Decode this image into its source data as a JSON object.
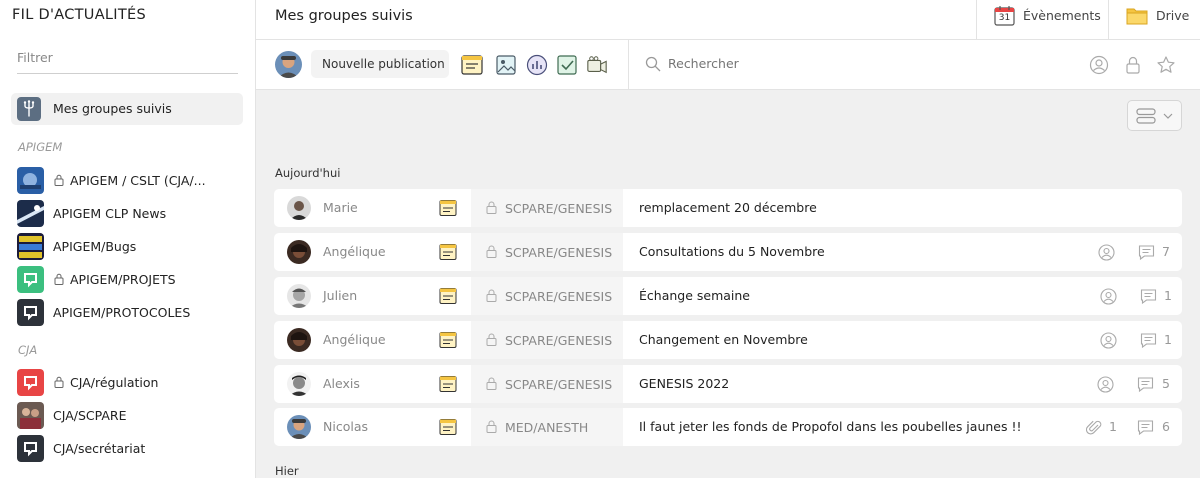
{
  "sidebar": {
    "title": "FIL D'ACTUALITÉS",
    "filter_placeholder": "Filtrer",
    "active_item": "Mes groupes suivis",
    "sections": [
      {
        "name": "APIGEM",
        "items": [
          {
            "label": "APIGEM / CSLT (CJA/...",
            "locked": true
          },
          {
            "label": "APIGEM CLP News",
            "locked": false
          },
          {
            "label": "APIGEM/Bugs",
            "locked": false
          },
          {
            "label": "APIGEM/PROJETS",
            "locked": true
          },
          {
            "label": "APIGEM/PROTOCOLES",
            "locked": false
          }
        ]
      },
      {
        "name": "CJA",
        "items": [
          {
            "label": "CJA/régulation",
            "locked": true
          },
          {
            "label": "CJA/SCPARE",
            "locked": false
          },
          {
            "label": "CJA/secrétariat",
            "locked": false
          }
        ]
      }
    ]
  },
  "header": {
    "title": "Mes groupes suivis",
    "events_label": "Évènements",
    "calendar_day": "31",
    "drive_label": "Drive"
  },
  "toolbar": {
    "new_post_label": "Nouvelle publication",
    "search_placeholder": "Rechercher"
  },
  "feed": {
    "days": [
      {
        "label": "Aujourd'hui",
        "posts": [
          {
            "author": "Marie",
            "group": "SCPARE/GENESIS",
            "title": "remplacement 20 décembre",
            "participants": false,
            "attachments": null,
            "comments": null
          },
          {
            "author": "Angélique",
            "group": "SCPARE/GENESIS",
            "title": "Consultations du 5 Novembre",
            "participants": true,
            "attachments": null,
            "comments": "7"
          },
          {
            "author": "Julien",
            "group": "SCPARE/GENESIS",
            "title": "Échange semaine",
            "participants": true,
            "attachments": null,
            "comments": "1"
          },
          {
            "author": "Angélique",
            "group": "SCPARE/GENESIS",
            "title": "Changement en Novembre",
            "participants": true,
            "attachments": null,
            "comments": "1"
          },
          {
            "author": "Alexis",
            "group": "SCPARE/GENESIS",
            "title": "GENESIS 2022",
            "participants": true,
            "attachments": null,
            "comments": "5"
          },
          {
            "author": "Nicolas",
            "group": "MED/ANESTH",
            "title": "Il faut jeter les fonds de Propofol dans les poubelles jaunes !!",
            "participants": false,
            "attachments": "1",
            "comments": "6"
          }
        ]
      },
      {
        "label": "Hier",
        "posts": []
      }
    ]
  },
  "colors": {
    "accent_red": "#e84545",
    "accent_green": "#3bbf7f",
    "note_yellow": "#f5c542",
    "feed_bg": "#f0f0f0"
  }
}
